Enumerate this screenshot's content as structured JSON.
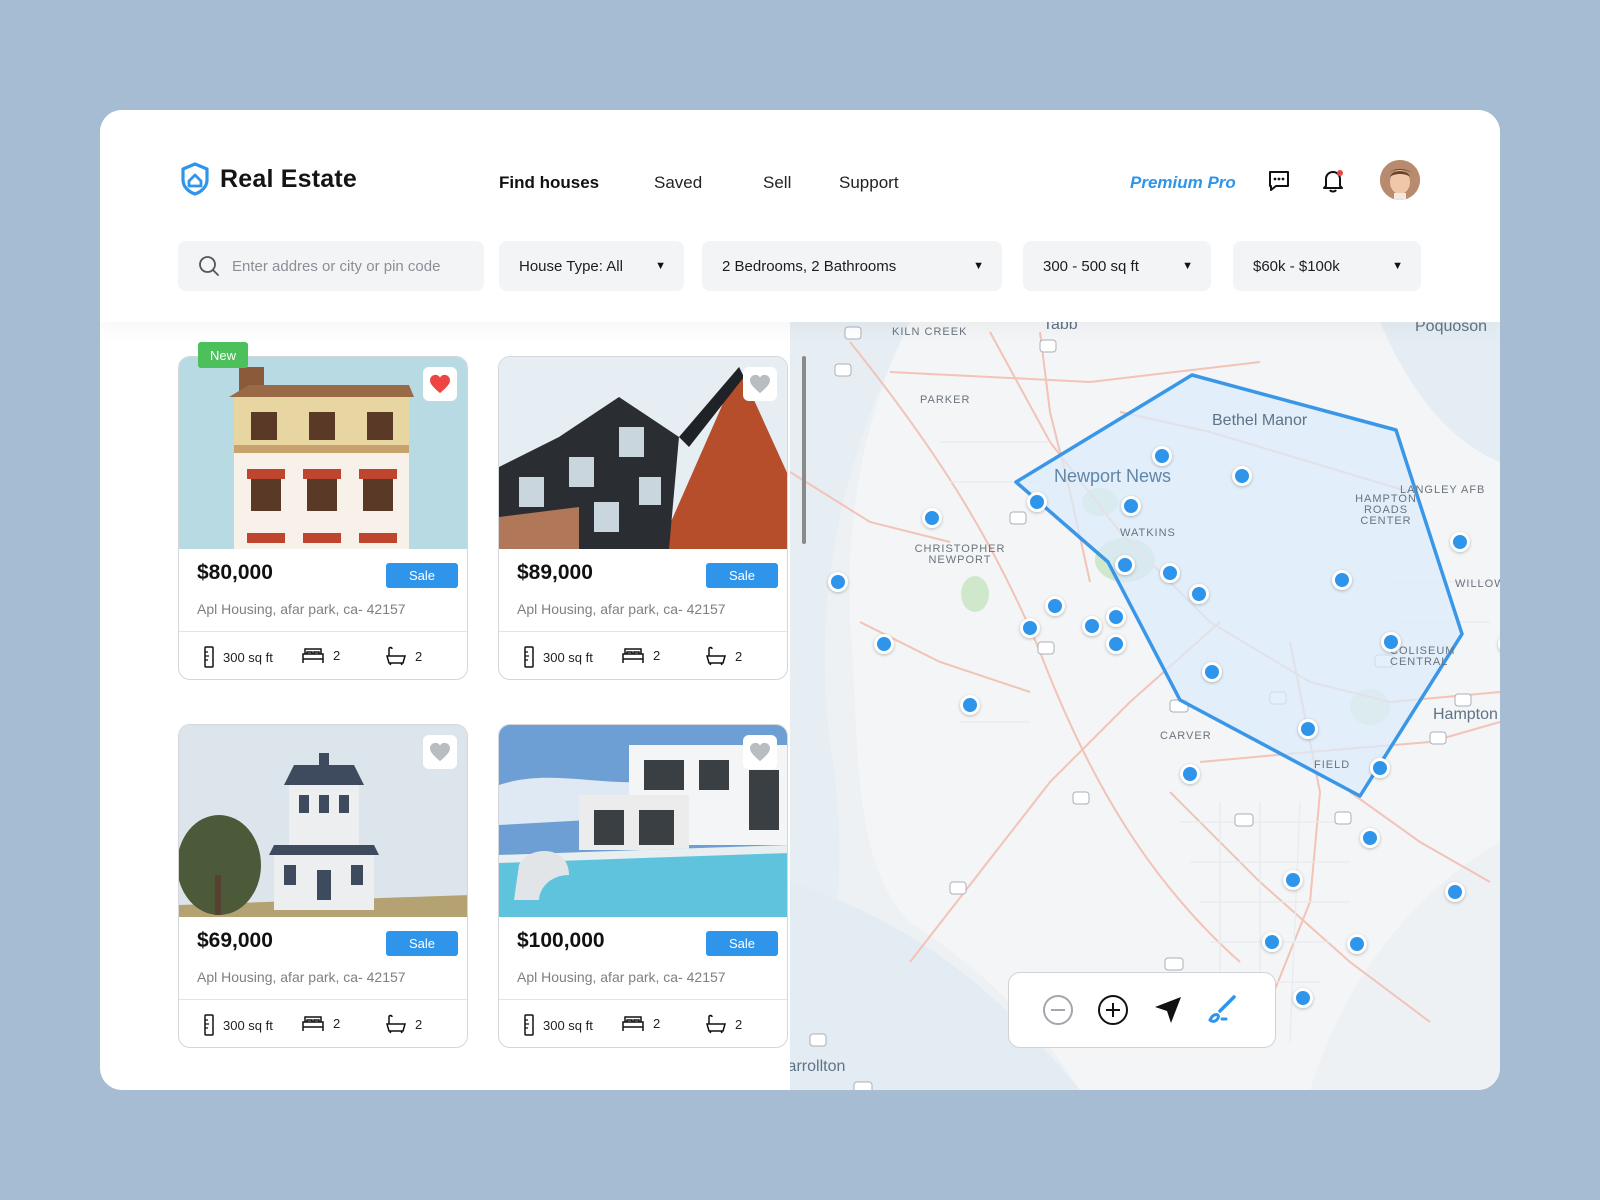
{
  "app": {
    "title": "Real Estate"
  },
  "nav": {
    "items": [
      "Find houses",
      "Saved",
      "Sell",
      "Support"
    ],
    "active": "Find houses"
  },
  "header": {
    "premium": "Premium Pro",
    "icons": [
      "message-icon",
      "bell-icon",
      "avatar"
    ]
  },
  "search": {
    "placeholder": "Enter addres or city or pin code",
    "value": ""
  },
  "filters": {
    "house_type": "House Type: All",
    "rooms": "2 Bedrooms, 2 Bathrooms",
    "area": "300 - 500 sq ft",
    "price": "$60k - $100k"
  },
  "listings": [
    {
      "price": "$80,000",
      "status": "Sale",
      "address": "Apl Housing, afar park, ca- 42157",
      "area": "300 sq ft",
      "beds": "2",
      "baths": "2",
      "favorite": true,
      "badge": "New"
    },
    {
      "price": "$89,000",
      "status": "Sale",
      "address": "Apl Housing, afar park, ca- 42157",
      "area": "300 sq ft",
      "beds": "2",
      "baths": "2",
      "favorite": false
    },
    {
      "price": "$69,000",
      "status": "Sale",
      "address": "Apl Housing, afar park, ca- 42157",
      "area": "300 sq ft",
      "beds": "2",
      "baths": "2",
      "favorite": false
    },
    {
      "price": "$100,000",
      "status": "Sale",
      "address": "Apl Housing, afar park, ca- 42157",
      "area": "300 sq ft",
      "beds": "2",
      "baths": "2",
      "favorite": false
    }
  ],
  "map": {
    "labels": {
      "kiln_creek": "KILN CREEK",
      "tabb": "Tabb",
      "poquoson": "Poquoson",
      "parker": "PARKER",
      "bethel_manor": "Bethel Manor",
      "newport_news": "Newport News",
      "hampton_roads": "HAMPTON ROADS CENTER",
      "langley": "LANGLEY AFB",
      "christopher_newport": "CHRISTOPHER NEWPORT",
      "watkins": "WATKINS",
      "willow": "WILLOW",
      "coliseum": "COLISEUM CENTRAL",
      "hampton": "Hampton",
      "carver": "CARVER",
      "field": "FIELD",
      "carrollton": "Carrollton"
    },
    "controls": [
      "zoom-out",
      "zoom-in",
      "locate",
      "draw-area"
    ],
    "colors": {
      "pin": "#2f95ea",
      "polygon_stroke": "#3a97e8",
      "polygon_fill": "#dcebfa",
      "accent": "#2f95ea",
      "favorite": "#ef4444",
      "new_badge": "#4cc05a"
    }
  }
}
